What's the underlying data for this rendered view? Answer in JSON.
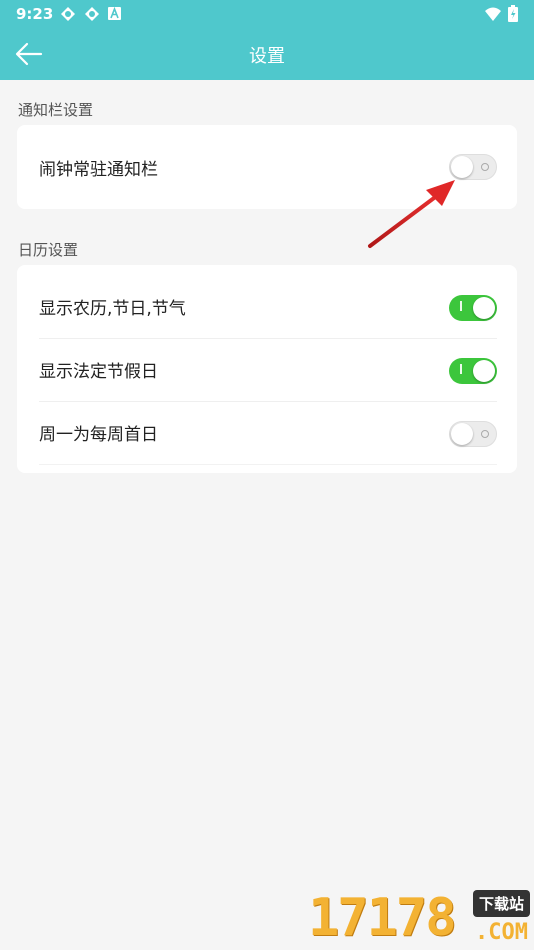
{
  "status_bar": {
    "time": "9:23",
    "icons": [
      "sync-icon",
      "sync-icon",
      "a-icon"
    ],
    "right_icons": [
      "wifi-icon",
      "battery-icon"
    ]
  },
  "app_bar": {
    "title": "设置",
    "back_icon": "arrow-left-icon",
    "color": "#4fc8cc"
  },
  "notification_section": {
    "label": "通知栏设置",
    "items": [
      {
        "label": "闹钟常驻通知栏",
        "enabled": false
      }
    ]
  },
  "calendar_section": {
    "label": "日历设置",
    "items": [
      {
        "label": "显示农历,节日,节气",
        "enabled": true
      },
      {
        "label": "显示法定节假日",
        "enabled": true
      },
      {
        "label": "周一为每周首日",
        "enabled": false
      }
    ]
  },
  "colors": {
    "toggle_on": "#3cc63c",
    "toggle_off": "#ececec",
    "annotation_arrow": "#d32222"
  },
  "watermark": {
    "number": "17178",
    "badge": "下载站",
    "suffix": ".COM"
  }
}
